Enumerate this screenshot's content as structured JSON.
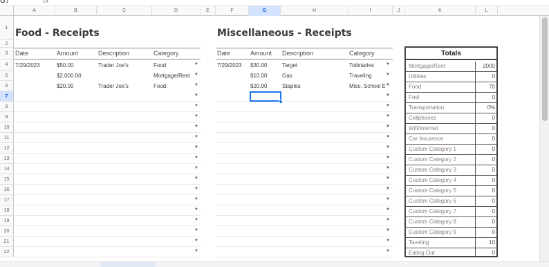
{
  "formula_bar": {
    "name_box": "G7",
    "fx": "fx"
  },
  "columns": [
    "A",
    "B",
    "C",
    "D",
    "E",
    "F",
    "G",
    "H",
    "I",
    "J",
    "K",
    "L"
  ],
  "rows": [
    "1",
    "2",
    "3",
    "4",
    "5",
    "6",
    "7",
    "8",
    "9",
    "10",
    "11",
    "12",
    "13",
    "14",
    "15",
    "16",
    "17",
    "18",
    "19",
    "20",
    "21",
    "22"
  ],
  "food": {
    "title": "Food - Receipts",
    "headers": {
      "date": "Date",
      "amount": "Amount",
      "description": "Description",
      "category": "Category"
    },
    "rows": [
      {
        "date": "7/29/2023",
        "amount": "$50.00",
        "description": "Trader Joe's",
        "category": "Food"
      },
      {
        "date": "",
        "amount": "$2,000.00",
        "description": "",
        "category": "Mortgage/Rent"
      },
      {
        "date": "",
        "amount": "$20.00",
        "description": "Trader Joe's",
        "category": "Food"
      }
    ]
  },
  "misc": {
    "title": "Miscellaneous - Receipts",
    "headers": {
      "date": "Date",
      "amount": "Amount",
      "description": "Description",
      "category": "Category"
    },
    "rows": [
      {
        "date": "7/29/2023",
        "amount": "$30.00",
        "description": "Target",
        "category": "Toiletaries"
      },
      {
        "date": "",
        "amount": "$10.00",
        "description": "Gas",
        "category": "Traveling"
      },
      {
        "date": "",
        "amount": "$20.00",
        "description": "Staples",
        "category": "Misc. School Ex"
      }
    ]
  },
  "totals": {
    "title": "Totals",
    "items": [
      {
        "label": "Mortgage/Rent",
        "value": "2000"
      },
      {
        "label": "Utilities",
        "value": "0"
      },
      {
        "label": "Food",
        "value": "70"
      },
      {
        "label": "Fuel",
        "value": "0"
      },
      {
        "label": "Transportation",
        "value": "0%"
      },
      {
        "label": "Cellphones",
        "value": "0"
      },
      {
        "label": "Wifi/Internet",
        "value": "0"
      },
      {
        "label": "Car Insurance",
        "value": "0"
      },
      {
        "label": "Custom Category 1",
        "value": "0"
      },
      {
        "label": "Custom Category 2",
        "value": "0"
      },
      {
        "label": "Custom Category 3",
        "value": "0"
      },
      {
        "label": "Custom Category 4",
        "value": "0"
      },
      {
        "label": "Custom Category 5",
        "value": "0"
      },
      {
        "label": "Custom Category 6",
        "value": "0"
      },
      {
        "label": "Custom Category 7",
        "value": "0"
      },
      {
        "label": "Custom Category 8",
        "value": "0"
      },
      {
        "label": "Custom Category 9",
        "value": "0"
      },
      {
        "label": "Taveling",
        "value": "10"
      },
      {
        "label": "Eating Out",
        "value": "0"
      }
    ]
  },
  "icons": {
    "dropdown": "dropdown-arrow-icon"
  },
  "colors": {
    "accent": "#1a73e8",
    "active_header": "#d3e3fd"
  }
}
